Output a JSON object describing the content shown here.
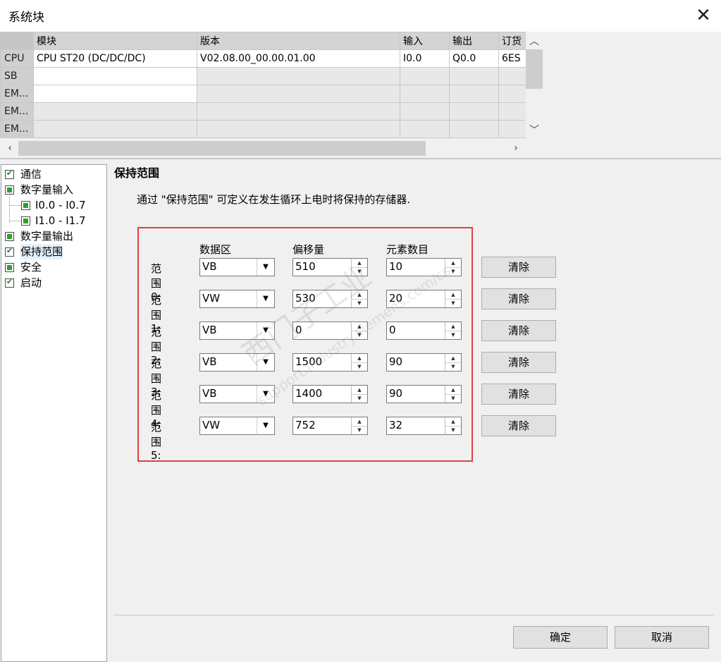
{
  "window": {
    "title": "系统块",
    "close_glyph": "✕"
  },
  "grid": {
    "columns": [
      "模块",
      "版本",
      "输入",
      "输出",
      "订货"
    ],
    "rows": [
      {
        "head": "CPU",
        "cells": [
          "CPU ST20 (DC/DC/DC)",
          "V02.08.00_00.00.01.00",
          "I0.0",
          "Q0.0",
          "6ES"
        ]
      },
      {
        "head": "SB",
        "cells": [
          "",
          "",
          "",
          "",
          ""
        ]
      },
      {
        "head": "EM...",
        "cells": [
          "",
          "",
          "",
          "",
          ""
        ]
      },
      {
        "head": "EM...",
        "cells": [
          "",
          "",
          "",
          "",
          ""
        ]
      },
      {
        "head": "EM...",
        "cells": [
          "",
          "",
          "",
          "",
          ""
        ]
      }
    ]
  },
  "tree": {
    "items": [
      {
        "label": "通信"
      },
      {
        "label": "数字量输入"
      },
      {
        "label": "I0.0 - I0.7"
      },
      {
        "label": "I1.0 - I1.7"
      },
      {
        "label": "数字量输出"
      },
      {
        "label": "保持范围"
      },
      {
        "label": "安全"
      },
      {
        "label": "启动"
      }
    ]
  },
  "retentive": {
    "title": "保持范围",
    "description": "通过 \"保持范围\" 可定义在发生循环上电时将保持的存储器.",
    "col_area": "数据区",
    "col_offset": "偏移量",
    "col_count": "元素数目",
    "clear_label": "清除",
    "ranges": [
      {
        "label": "范围 0:",
        "area": "VB",
        "offset": "510",
        "count": "10"
      },
      {
        "label": "范围 1:",
        "area": "VW",
        "offset": "530",
        "count": "20"
      },
      {
        "label": "范围 2:",
        "area": "VB",
        "offset": "0",
        "count": "0"
      },
      {
        "label": "范围 3:",
        "area": "VB",
        "offset": "1500",
        "count": "90"
      },
      {
        "label": "范围 4:",
        "area": "VB",
        "offset": "1400",
        "count": "90"
      },
      {
        "label": "范围 5:",
        "area": "VW",
        "offset": "752",
        "count": "32"
      }
    ]
  },
  "footer": {
    "ok_label": "确定",
    "cancel_label": "取消"
  },
  "watermark": {
    "line1": "西门子工业",
    "line2": "support.industry.siemens.com/cs"
  },
  "colors": {
    "highlight_border": "#e04040",
    "check_green": "#2ca02c"
  }
}
